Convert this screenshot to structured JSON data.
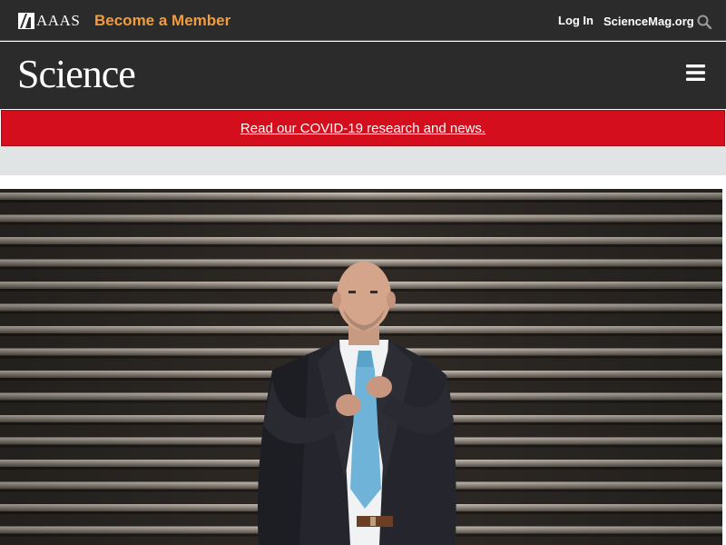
{
  "header": {
    "logo_text": "AAAS",
    "become_member": "Become a Member",
    "login": "Log In",
    "site_link": "ScienceMag.org",
    "icons": {
      "search": "search-icon",
      "menu": "hamburger-menu-icon"
    }
  },
  "masthead": {
    "logo": "Science"
  },
  "banner": {
    "link_text": "Read our COVID-19 research and news."
  },
  "colors": {
    "bar_bg": "#2b2b2b",
    "accent": "#f39c3c",
    "banner_red": "#d50e1d",
    "strip_gray": "#e1e4e5"
  }
}
